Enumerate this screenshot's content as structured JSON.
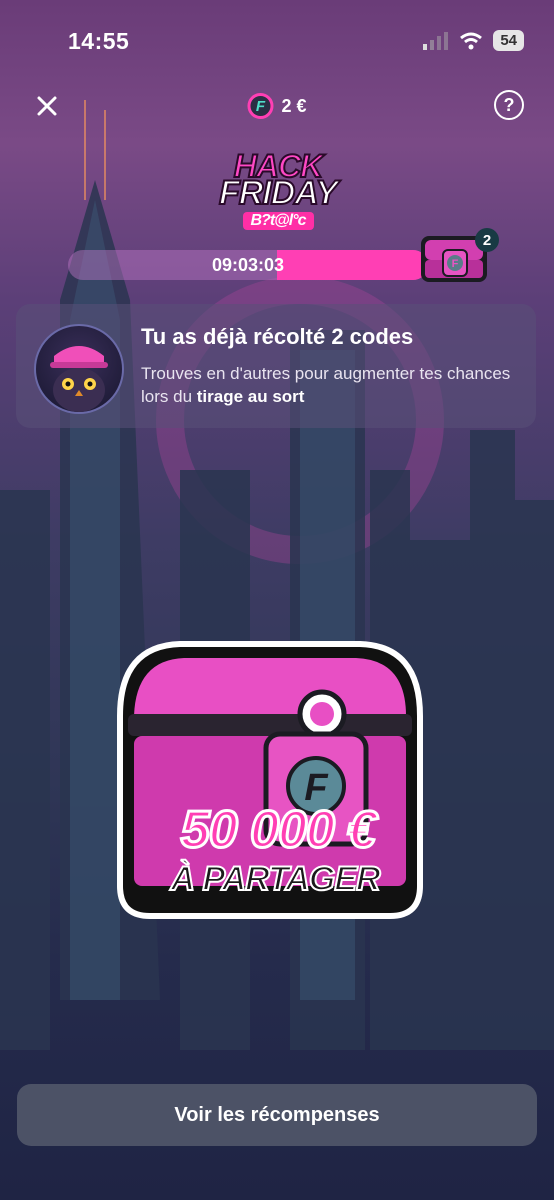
{
  "status_bar": {
    "time": "14:55",
    "battery": "54"
  },
  "nav": {
    "balance": "2 €",
    "help_label": "?"
  },
  "logo": {
    "line1": "HACK",
    "line2": "FRIDAY",
    "brand": "B?t@l°c"
  },
  "timer": {
    "value": "09:03:03",
    "progress": 0.42
  },
  "chest_badge": "2",
  "info_card": {
    "title": "Tu as déjà récolté 2 codes",
    "body_prefix": "Trouves en d'autres pour augmenter tes chances lors du ",
    "body_bold": "tirage au sort"
  },
  "prize": {
    "amount": "50 000 €",
    "caption": "À PARTAGER"
  },
  "cta": {
    "label": "Voir les récompenses"
  },
  "colors": {
    "accent": "#ff3fb4",
    "teal": "#4ee0c9",
    "button": "#4c5266"
  },
  "icons": [
    "close-icon",
    "coin-icon",
    "help-icon",
    "wifi-icon",
    "signal-icon",
    "battery-icon"
  ]
}
